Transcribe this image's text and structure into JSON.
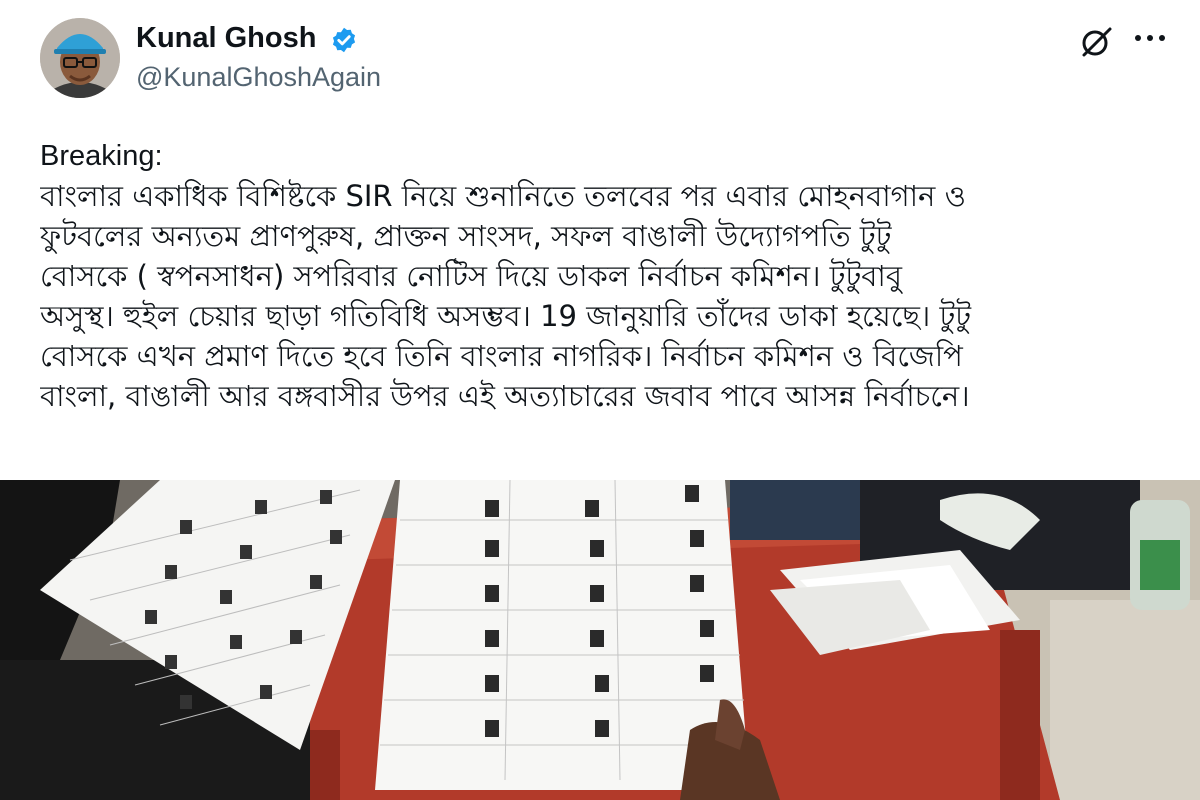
{
  "tweet": {
    "author_name": "Kunal Ghosh",
    "handle": "@KunalGhoshAgain",
    "verified_icon": "verified-badge-icon",
    "action_icons": [
      "grok-icon",
      "more-options-icon"
    ],
    "text_lines": [
      "Breaking:",
      "বাংলার একাধিক বিশিষ্টকে SIR নিয়ে শুনানিতে তলবের পর এবার মোহনবাগান ও",
      "ফুটবলের অন্যতম প্রাণপুরুষ, প্রাক্তন সাংসদ, সফল বাঙালী উদ্যোগপতি টুটু",
      "বোসকে ( স্বপনসাধন) সপরিবার নোটিস দিয়ে ডাকল নির্বাচন কমিশন। টুটুবাবু",
      "অসুস্থ। হুইল চেয়ার ছাড়া গতিবিধি অসম্ভব। 19 জানুয়ারি তাঁদের ডাকা হয়েছে। টুটু",
      "বোসকে এখন প্রমাণ দিতে হবে তিনি বাংলার নাগরিক। নির্বাচন কমিশন ও বিজেপি",
      "বাংলা, বাঙালী আর বঙ্গবাসীর উপর এই অত্যাচারের জবাব পাবে আসন্ন নির্বাচনে।"
    ]
  },
  "colors": {
    "text_primary": "#0f1419",
    "text_secondary": "#536471",
    "verified_blue": "#1d9bf0",
    "table_red": "#b23a2a"
  }
}
